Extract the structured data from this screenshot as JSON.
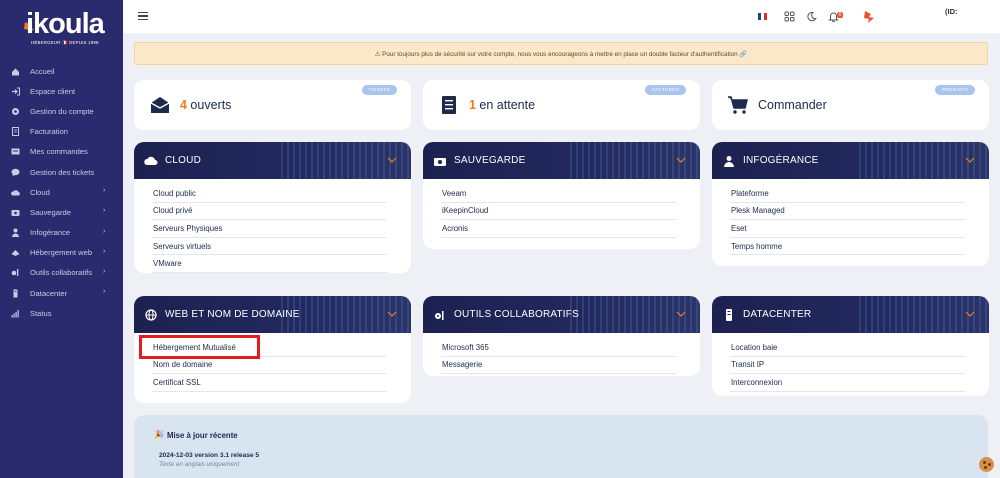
{
  "brand": {
    "name": "ikoula",
    "tagline": "HÉBERGEUR 🇫🇷 DEPUIS 1998",
    "accent": "#f07c1c",
    "sidebar_bg": "#2a2a6e"
  },
  "sidebar": {
    "items": [
      {
        "label": "Accueil",
        "icon": "home-icon",
        "chevron": false
      },
      {
        "label": "Espace client",
        "icon": "login-icon",
        "chevron": false
      },
      {
        "label": "Gestion du compte",
        "icon": "gear-icon",
        "chevron": false
      },
      {
        "label": "Facturation",
        "icon": "invoice-icon",
        "chevron": false
      },
      {
        "label": "Mes commandes",
        "icon": "orders-icon",
        "chevron": false
      },
      {
        "label": "Gestion des tickets",
        "icon": "chat-icon",
        "chevron": false
      },
      {
        "label": "Cloud",
        "icon": "cloud-icon",
        "chevron": true
      },
      {
        "label": "Sauvegarde",
        "icon": "backup-icon",
        "chevron": true
      },
      {
        "label": "Infogérance",
        "icon": "user-tie-icon",
        "chevron": true
      },
      {
        "label": "Hébergement web",
        "icon": "hosting-icon",
        "chevron": true
      },
      {
        "label": "Outils collaboratifs",
        "icon": "tools-icon",
        "chevron": true
      },
      {
        "label": "Datacenter",
        "icon": "server-icon",
        "chevron": true
      },
      {
        "label": "Status",
        "icon": "signal-icon",
        "chevron": false
      }
    ]
  },
  "topbar": {
    "id_label": "(ID:",
    "notification_count": "0",
    "icons": [
      "hamburger-icon",
      "french-flag-icon",
      "apps-grid-icon",
      "moon-icon",
      "bell-icon",
      "avatar"
    ]
  },
  "alert": {
    "text": "⚠ Pour toujours plus de sécurité sur votre compte, nous vous encourageons à mettre en place un double facteur d'authentification 🔗"
  },
  "stats": [
    {
      "number": "4",
      "text": " ouverts",
      "badge": "TICKETS",
      "icon": "envelope-icon"
    },
    {
      "number": "1",
      "text": " en attente",
      "badge": "FACTURES",
      "icon": "document-icon"
    },
    {
      "number": "",
      "text": "Commander",
      "badge": "PRODUITS",
      "icon": "cart-icon"
    }
  ],
  "cards": [
    {
      "title": "CLOUD",
      "icon": "cloud-icon",
      "items": [
        "Cloud public",
        "Cloud privé",
        "Serveurs Physiques",
        "Serveurs virtuels",
        "VMware"
      ]
    },
    {
      "title": "SAUVEGARDE",
      "icon": "backup-icon",
      "items": [
        "Veeam",
        "iKeepinCloud",
        "Acronis"
      ]
    },
    {
      "title": "INFOGÉRANCE",
      "icon": "user-tie-icon",
      "items": [
        "Plateforme",
        "Plesk Managed",
        "Eset",
        "Temps homme"
      ]
    },
    {
      "title": "WEB ET NOM DE DOMAINE",
      "icon": "globe-icon",
      "items": [
        "Hébergement Mutualisé",
        "Nom de domaine",
        "Certificat SSL"
      ]
    },
    {
      "title": "OUTILS COLLABORATIFS",
      "icon": "tools-icon",
      "items": [
        "Microsoft 365",
        "Messagerie"
      ]
    },
    {
      "title": "DATACENTER",
      "icon": "server-icon",
      "items": [
        "Location baie",
        "Transit IP",
        "Interconnexion"
      ]
    }
  ],
  "update": {
    "title": "Mise à jour récente",
    "icon": "🎉",
    "version": "2024-12-03 version 3.1 release 5",
    "note": "Texte en anglais uniquement"
  }
}
